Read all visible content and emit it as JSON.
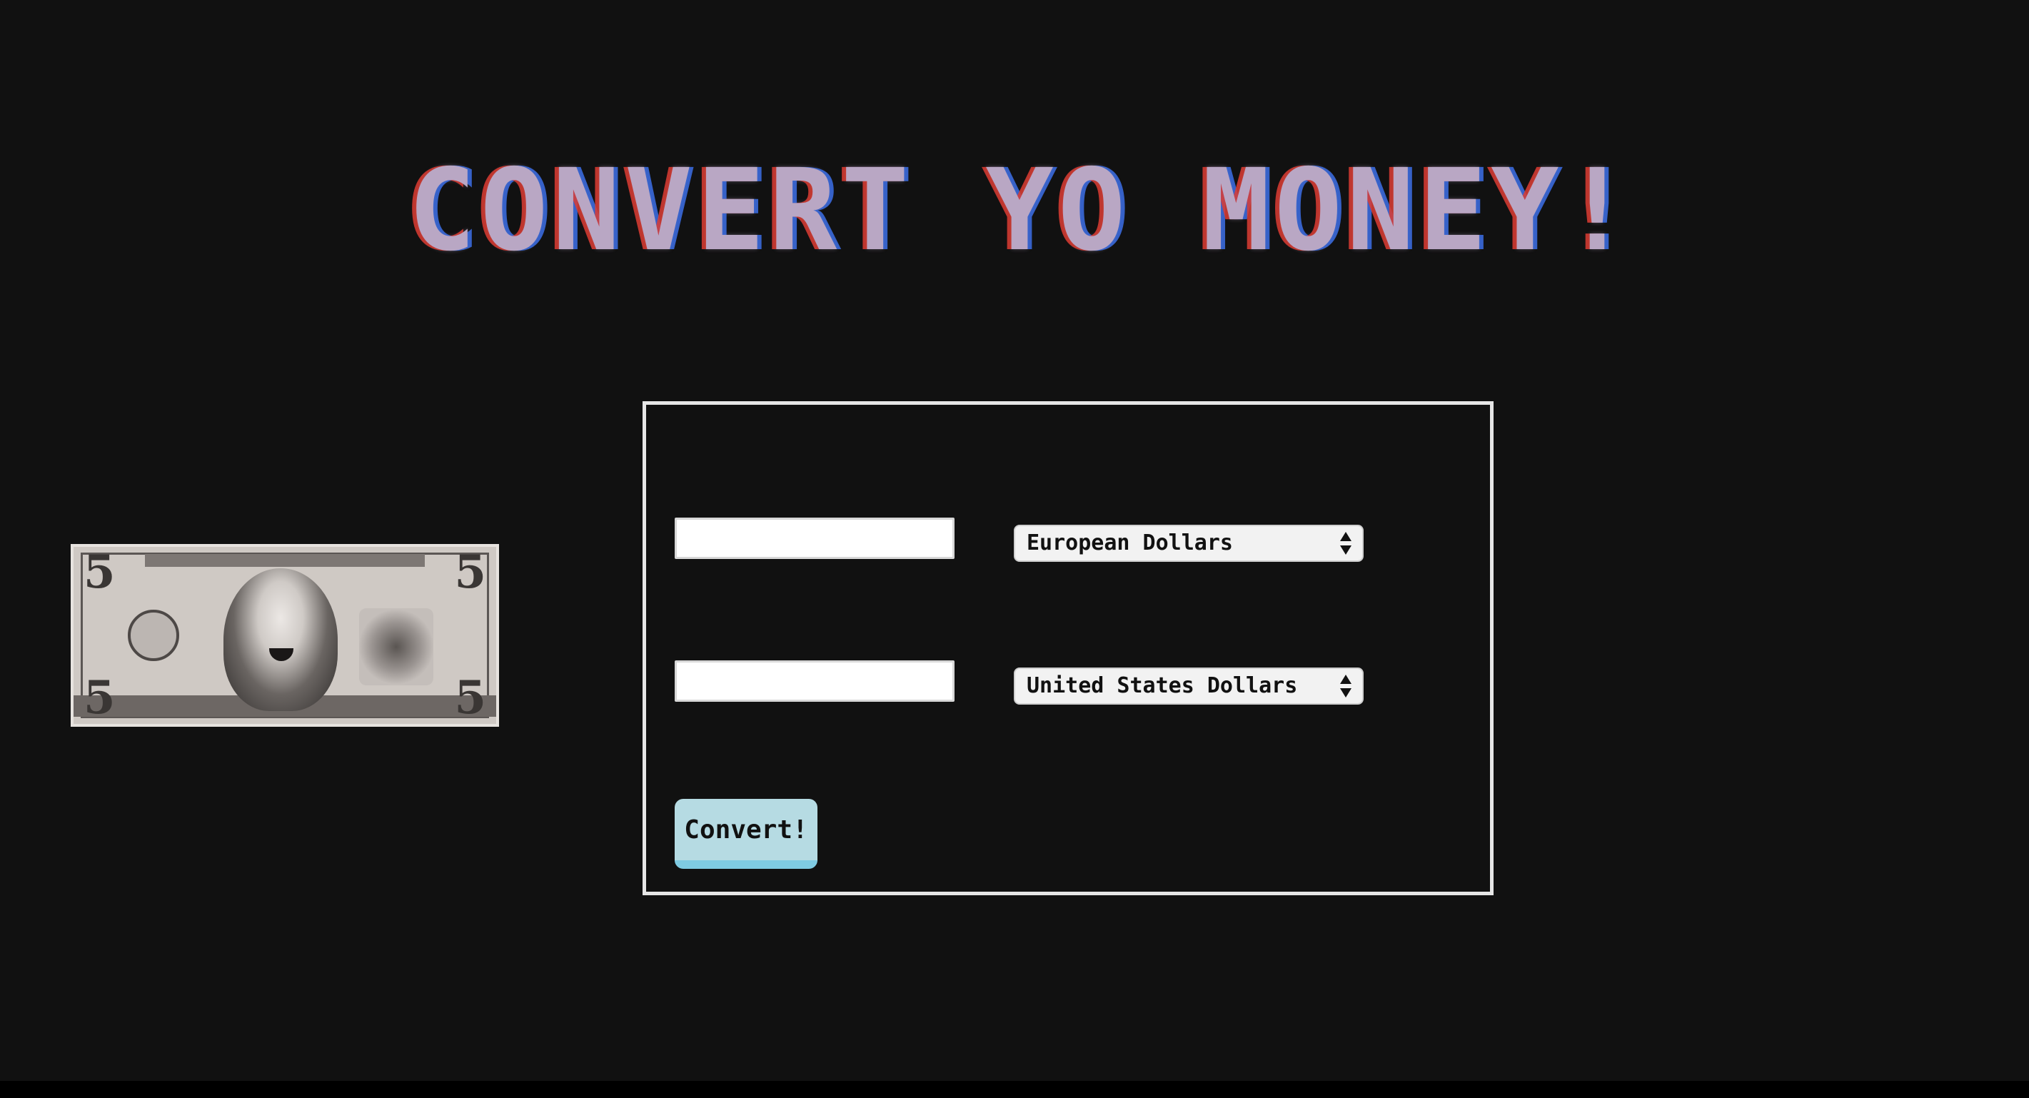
{
  "page": {
    "title": "CONVERT YO MONEY!",
    "background_color": "#111111"
  },
  "bill_image": {
    "icon": "five-dollar-bill-icon",
    "corner_numeral": "5"
  },
  "converter": {
    "from": {
      "amount_value": "",
      "currency_selected": "European Dollars"
    },
    "to": {
      "amount_value": "",
      "currency_selected": "United States Dollars"
    },
    "convert_label": "Convert!",
    "button_color": "#b6dbe3",
    "panel_border_color": "#e6e6e6"
  }
}
